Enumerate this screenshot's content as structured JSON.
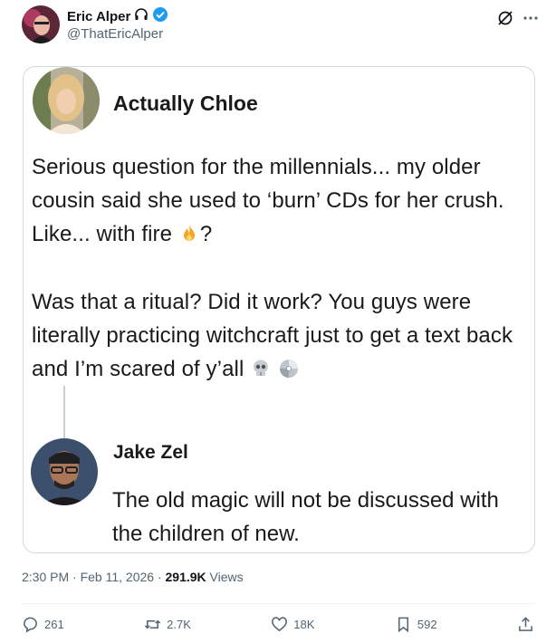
{
  "author": {
    "name": "Eric Alper",
    "handle": "@ThatEricAlper"
  },
  "quote": {
    "author_name": "Actually Chloe",
    "paragraph1": "Serious question for the millennials... my older cousin said she used to ‘burn’ CDs for her crush. Like... with fire",
    "paragraph1_end": "?",
    "paragraph2": "Was that a ritual? Did it work? You guys were literally practicing witchcraft just to get a text back and I’m scared of y’all",
    "reply_name": "Jake Zel",
    "reply_text": "The old magic will not be discussed with the children of new."
  },
  "meta": {
    "timestamp": "2:30 PM · Feb 11, 2026 · ",
    "views_count": "291.9K",
    "views_label": " Views"
  },
  "actions": {
    "replies": "261",
    "reposts": "2.7K",
    "likes": "18K",
    "bookmarks": "592"
  },
  "icons": {
    "headphones": "headphones-icon",
    "verified": "verified-badge-icon",
    "grok": "grok-icon",
    "more": "more-icon"
  },
  "colors": {
    "verified_blue": "#1d9bf0",
    "text_primary": "#0f1419",
    "text_secondary": "#536471"
  }
}
